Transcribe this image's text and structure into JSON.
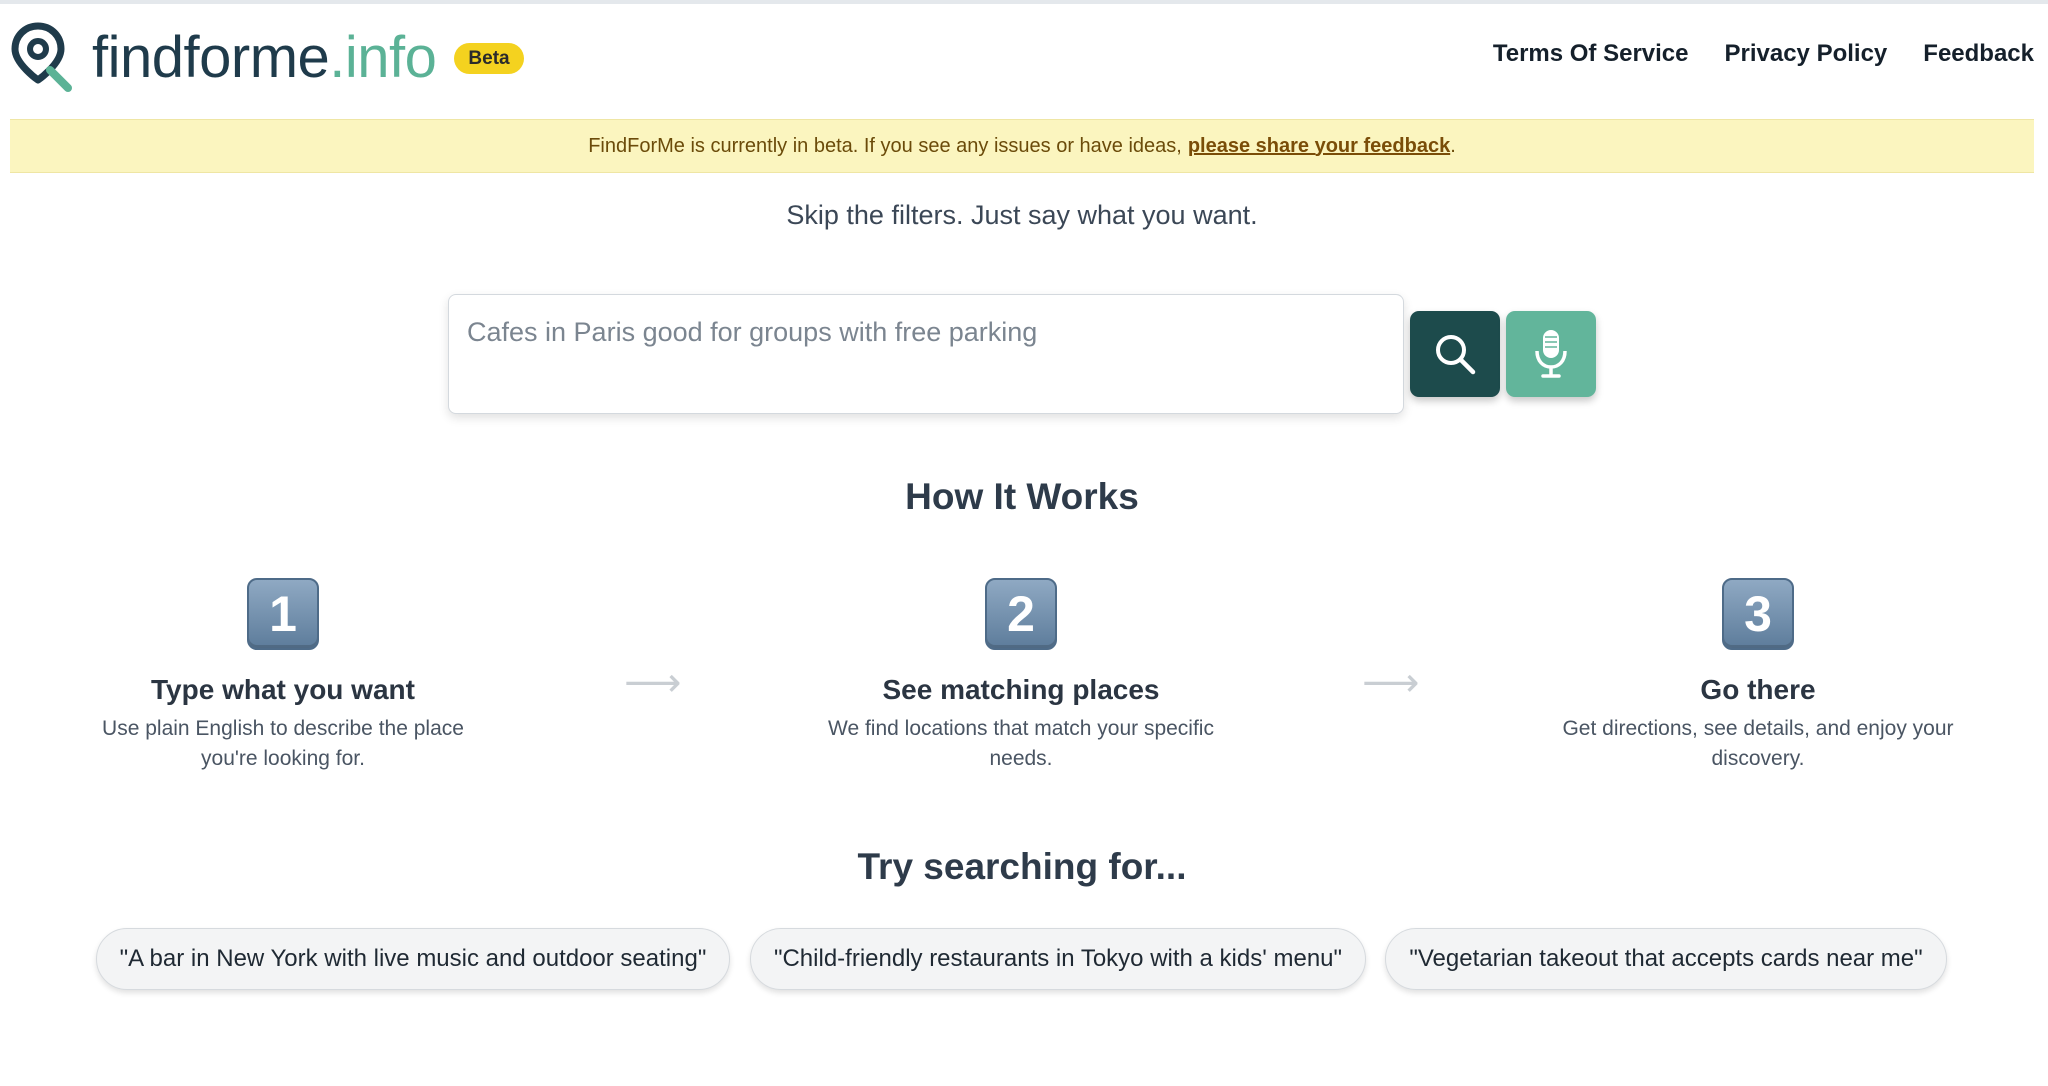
{
  "header": {
    "logo_main": "findforme",
    "logo_ext": ".info",
    "beta_label": "Beta",
    "nav": [
      "Terms Of Service",
      "Privacy Policy",
      "Feedback"
    ]
  },
  "banner": {
    "text": "FindForMe is currently in beta. If you see any issues or have ideas,",
    "link_text": "please share your feedback",
    "suffix": "."
  },
  "tagline": "Skip the filters. Just say what you want.",
  "search": {
    "placeholder": "Cafes in Paris good for groups with free parking",
    "value": ""
  },
  "how_it_works": {
    "title": "How It Works",
    "steps": [
      {
        "number": "1",
        "title": "Type what you want",
        "desc": "Use plain English to describe the place you're looking for."
      },
      {
        "number": "2",
        "title": "See matching places",
        "desc": "We find locations that match your specific needs."
      },
      {
        "number": "3",
        "title": "Go there",
        "desc": "Get directions, see details, and enjoy your discovery."
      }
    ],
    "arrow": "⟶"
  },
  "try_searching": {
    "title": "Try searching for...",
    "examples": [
      "\"A bar in New York with live music and outdoor seating\"",
      "\"Child-friendly restaurants in Tokyo with a kids' menu\"",
      "\"Vegetarian takeout that accepts cards near me\""
    ]
  },
  "colors": {
    "brand_dark": "#1f3b4b",
    "brand_green": "#5bb296",
    "search_button": "#1d4b4c",
    "mic_button": "#62b59b",
    "beta_badge": "#f4d21f",
    "banner_bg": "#fbf5bf"
  },
  "icons": [
    "location-search-icon",
    "search-icon",
    "microphone-icon",
    "arrow-right-icon"
  ]
}
